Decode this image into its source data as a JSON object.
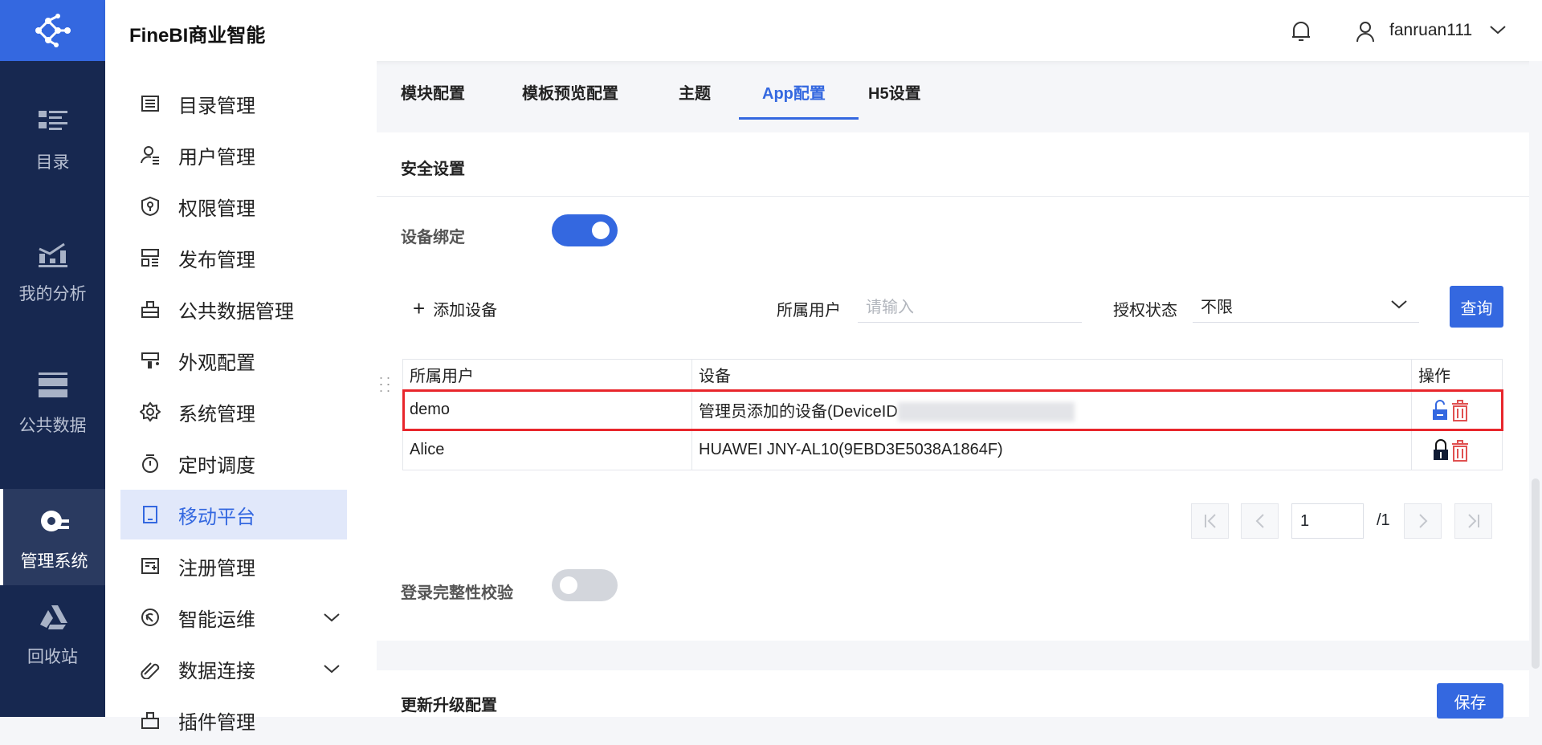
{
  "app": {
    "title": "FineBI商业智能",
    "user": "fanruan111"
  },
  "rail": [
    {
      "label": "目录"
    },
    {
      "label": "我的分析"
    },
    {
      "label": "公共数据"
    },
    {
      "label": "管理系统"
    },
    {
      "label": "回收站"
    }
  ],
  "nav": [
    "目录管理",
    "用户管理",
    "权限管理",
    "发布管理",
    "公共数据管理",
    "外观配置",
    "系统管理",
    "定时调度",
    "移动平台",
    "注册管理",
    "智能运维",
    "数据连接",
    "插件管理"
  ],
  "tabs": [
    "模块配置",
    "模板预览配置",
    "主题",
    "App配置",
    "H5设置"
  ],
  "security": {
    "title": "安全设置",
    "device_binding": "设备绑定",
    "device_binding_on": true,
    "add_device": "添加设备",
    "user_label": "所属用户",
    "user_placeholder": "请输入",
    "auth_label": "授权状态",
    "auth_value": "不限",
    "query": "查询",
    "login_check": "登录完整性校验",
    "login_check_on": false
  },
  "table": {
    "headers": [
      "所属用户",
      "设备",
      "操作"
    ],
    "rows": [
      {
        "user": "demo",
        "device": "管理员添加的设备(DeviceID",
        "locked": false
      },
      {
        "user": "Alice",
        "device": "HUAWEI JNY-AL10(9EBD3E5038A1864F)",
        "locked": true
      }
    ]
  },
  "pagination": {
    "page": "1",
    "total": "/1"
  },
  "update": {
    "title": "更新升级配置",
    "save": "保存"
  }
}
